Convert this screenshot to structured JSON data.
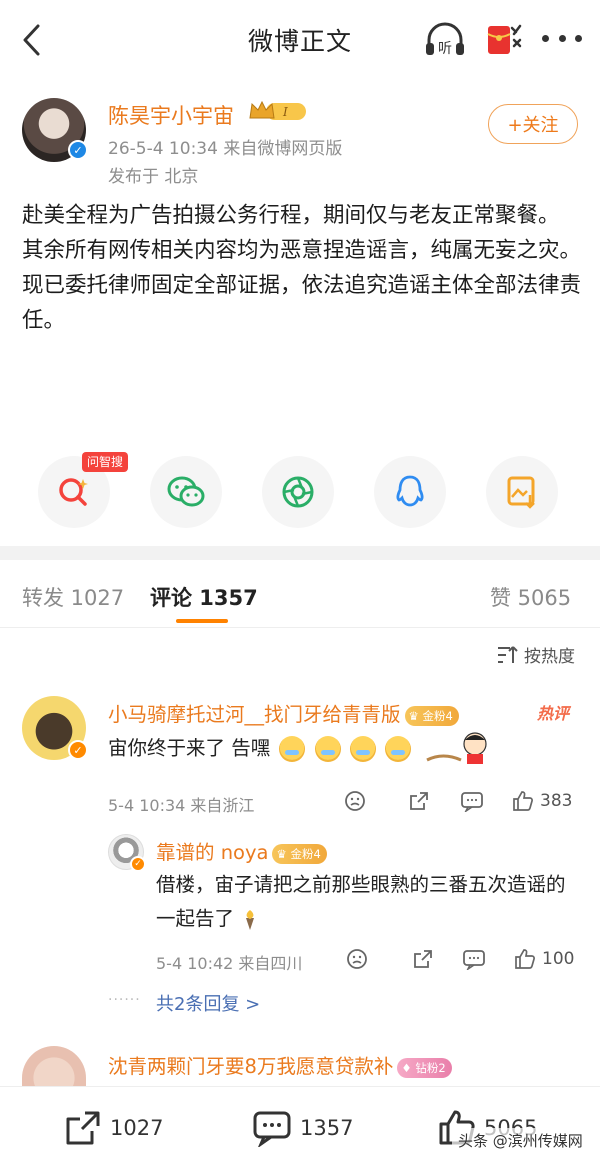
{
  "topbar": {
    "title": "微博正文",
    "listen_label": "听"
  },
  "author": {
    "name": "陈昊宇小宇宙",
    "level": "I",
    "meta": "26-5-4 10:34  来自微博网页版",
    "location": "发布于 北京",
    "follow_label": "+关注"
  },
  "post": {
    "lines": [
      "赴美全程为广告拍摄公务行程，期间仅与老友正常聚餐。",
      "其余所有网传相关内容均为恶意捏造谣言，纯属无妄之灾。",
      "现已委托律师固定全部证据，依法追究造谣主体全部法律责任。"
    ]
  },
  "share": {
    "ai_tag": "问智搜"
  },
  "tabs": {
    "repost": "转发 1027",
    "comment": "评论 1357",
    "like": "赞 5065"
  },
  "sort_label": "按热度",
  "comments": [
    {
      "name": "小马骑摩托过河__找门牙给青青版",
      "badge": "金粉4",
      "hot": "热评",
      "text": "宙你终于来了 告嘿",
      "meta": "5-4 10:34  来自浙江",
      "likes": "383"
    }
  ],
  "reply": {
    "name": "靠谱的 noya",
    "badge": "金粉4",
    "text": "借楼，宙子请把之前那些眼熟的三番五次造谣的一起告了",
    "meta": "5-4 10:42  来自四川",
    "likes": "100",
    "more_replies": "共2条回复 >"
  },
  "third_comment": {
    "name": "沈青两颗门牙要8万我愿意贷款补",
    "badge": "钻粉2"
  },
  "bottom": {
    "repost": "1027",
    "comment": "1357",
    "like": "5065"
  },
  "watermark": "头条 @滨州传媒网",
  "colors": {
    "accent": "#ff8200",
    "name": "#ea7a1e",
    "link": "#4a6fb3"
  }
}
